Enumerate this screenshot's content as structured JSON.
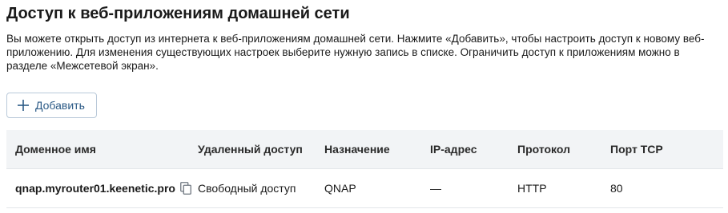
{
  "page": {
    "title": "Доступ к веб-приложениям домашней сети",
    "description": "Вы можете открыть доступ из интернета к веб-приложениям домашней сети. Нажмите «Добавить», чтобы настроить доступ к новому веб-приложению. Для изменения существующих настроек выберите нужную запись в списке. Ограничить доступ к приложениям можно в разделе «Межсетевой экран»."
  },
  "toolbar": {
    "add_label": "Добавить",
    "add_icon": "plus-icon"
  },
  "table": {
    "columns": [
      "Доменное имя",
      "Удаленный доступ",
      "Назначение",
      "IP-адрес",
      "Протокол",
      "Порт TCP"
    ],
    "rows": [
      {
        "domain": "qnap.myrouter01.keenetic.pro",
        "remote_access": "Свободный доступ",
        "destination": "QNAP",
        "ip": "—",
        "protocol": "HTTP",
        "port": "80",
        "copy_icon": "copy-icon"
      }
    ]
  },
  "colors": {
    "accent": "#2b5a86",
    "header_bg": "#f2f4f6",
    "border": "#e3e6ea"
  }
}
